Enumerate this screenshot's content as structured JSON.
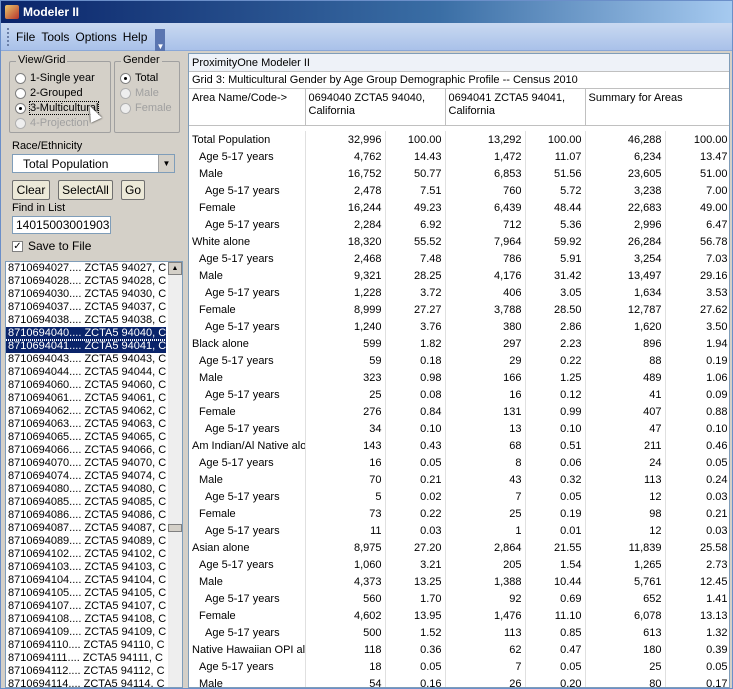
{
  "window": {
    "title": "Modeler II"
  },
  "menu": {
    "items": [
      "File",
      "Tools",
      "Options",
      "Help"
    ]
  },
  "viewgrid": {
    "legend": "View/Grid",
    "options": [
      "1-Single year",
      "2-Grouped",
      "3-Multicultural",
      "4-Projection"
    ],
    "selected": 2
  },
  "gender": {
    "legend": "Gender",
    "options": [
      "Total",
      "Male",
      "Female"
    ],
    "selected": 0
  },
  "race": {
    "label": "Race/Ethnicity",
    "value": "Total Population"
  },
  "buttons": {
    "clear": "Clear",
    "selectall": "SelectAll",
    "go": "Go"
  },
  "find": {
    "label": "Find in List",
    "value": "14015003001903"
  },
  "save": {
    "label": "Save to File",
    "checked": "✓"
  },
  "list": {
    "items": [
      "8710694027....  ZCTA5 94027, C",
      "8710694028....  ZCTA5 94028, C",
      "8710694030....  ZCTA5 94030, C",
      "8710694037....  ZCTA5 94037, C",
      "8710694038....  ZCTA5 94038, C",
      "8710694040....  ZCTA5 94040, C",
      "8710694041....  ZCTA5 94041, C",
      "8710694043....  ZCTA5 94043, C",
      "8710694044....  ZCTA5 94044, C",
      "8710694060....  ZCTA5 94060, C",
      "8710694061....  ZCTA5 94061, C",
      "8710694062....  ZCTA5 94062, C",
      "8710694063....  ZCTA5 94063, C",
      "8710694065....  ZCTA5 94065, C",
      "8710694066....  ZCTA5 94066, C",
      "8710694070....  ZCTA5 94070, C",
      "8710694074....  ZCTA5 94074, C",
      "8710694080....  ZCTA5 94080, C",
      "8710694085....  ZCTA5 94085, C",
      "8710694086....  ZCTA5 94086, C",
      "8710694087....  ZCTA5 94087, C",
      "8710694089....  ZCTA5 94089, C",
      "8710694102....  ZCTA5 94102, C",
      "8710694103....  ZCTA5 94103, C",
      "8710694104....  ZCTA5 94104, C",
      "8710694105....  ZCTA5 94105, C",
      "8710694107....  ZCTA5 94107, C",
      "8710694108....  ZCTA5 94108, C",
      "8710694109....  ZCTA5 94109, C",
      "8710694110....  ZCTA5 94110, C",
      "8710694111....  ZCTA5 94111, C",
      "8710694112....  ZCTA5 94112, C",
      "8710694114....  ZCTA5 94114, C"
    ],
    "selected": [
      5,
      6
    ]
  },
  "grid": {
    "title": "ProximityOne Modeler II",
    "subtitle": "Grid 3: Multicultural Gender by Age Group Demographic Profile -- Census 2010",
    "headers": [
      "Area Name/Code->",
      "0694040 ZCTA5 94040, California",
      "",
      "0694041 ZCTA5 94041, California",
      "",
      "Summary for Areas",
      ""
    ],
    "rows": [
      {
        "indent": 0,
        "cells": [
          "Total Population",
          "32,996",
          "100.00",
          "13,292",
          "100.00",
          "46,288",
          "100.00"
        ]
      },
      {
        "indent": 1,
        "cells": [
          "Age 5-17 years",
          "4,762",
          "14.43",
          "1,472",
          "11.07",
          "6,234",
          "13.47"
        ]
      },
      {
        "indent": 1,
        "cells": [
          "Male",
          "16,752",
          "50.77",
          "6,853",
          "51.56",
          "23,605",
          "51.00"
        ]
      },
      {
        "indent": 2,
        "cells": [
          "Age 5-17 years",
          "2,478",
          "7.51",
          "760",
          "5.72",
          "3,238",
          "7.00"
        ]
      },
      {
        "indent": 1,
        "cells": [
          "Female",
          "16,244",
          "49.23",
          "6,439",
          "48.44",
          "22,683",
          "49.00"
        ]
      },
      {
        "indent": 2,
        "cells": [
          "Age 5-17 years",
          "2,284",
          "6.92",
          "712",
          "5.36",
          "2,996",
          "6.47"
        ]
      },
      {
        "indent": 0,
        "cells": [
          "White alone",
          "18,320",
          "55.52",
          "7,964",
          "59.92",
          "26,284",
          "56.78"
        ]
      },
      {
        "indent": 1,
        "cells": [
          "Age 5-17 years",
          "2,468",
          "7.48",
          "786",
          "5.91",
          "3,254",
          "7.03"
        ]
      },
      {
        "indent": 1,
        "cells": [
          "Male",
          "9,321",
          "28.25",
          "4,176",
          "31.42",
          "13,497",
          "29.16"
        ]
      },
      {
        "indent": 2,
        "cells": [
          "Age 5-17 years",
          "1,228",
          "3.72",
          "406",
          "3.05",
          "1,634",
          "3.53"
        ]
      },
      {
        "indent": 1,
        "cells": [
          "Female",
          "8,999",
          "27.27",
          "3,788",
          "28.50",
          "12,787",
          "27.62"
        ]
      },
      {
        "indent": 2,
        "cells": [
          "Age 5-17 years",
          "1,240",
          "3.76",
          "380",
          "2.86",
          "1,620",
          "3.50"
        ]
      },
      {
        "indent": 0,
        "cells": [
          "Black alone",
          "599",
          "1.82",
          "297",
          "2.23",
          "896",
          "1.94"
        ]
      },
      {
        "indent": 1,
        "cells": [
          "Age 5-17 years",
          "59",
          "0.18",
          "29",
          "0.22",
          "88",
          "0.19"
        ]
      },
      {
        "indent": 1,
        "cells": [
          "Male",
          "323",
          "0.98",
          "166",
          "1.25",
          "489",
          "1.06"
        ]
      },
      {
        "indent": 2,
        "cells": [
          "Age 5-17 years",
          "25",
          "0.08",
          "16",
          "0.12",
          "41",
          "0.09"
        ]
      },
      {
        "indent": 1,
        "cells": [
          "Female",
          "276",
          "0.84",
          "131",
          "0.99",
          "407",
          "0.88"
        ]
      },
      {
        "indent": 2,
        "cells": [
          "Age 5-17 years",
          "34",
          "0.10",
          "13",
          "0.10",
          "47",
          "0.10"
        ]
      },
      {
        "indent": 0,
        "cells": [
          "Am Indian/Al Native alor",
          "143",
          "0.43",
          "68",
          "0.51",
          "211",
          "0.46"
        ]
      },
      {
        "indent": 1,
        "cells": [
          "Age 5-17 years",
          "16",
          "0.05",
          "8",
          "0.06",
          "24",
          "0.05"
        ]
      },
      {
        "indent": 1,
        "cells": [
          "Male",
          "70",
          "0.21",
          "43",
          "0.32",
          "113",
          "0.24"
        ]
      },
      {
        "indent": 2,
        "cells": [
          "Age 5-17 years",
          "5",
          "0.02",
          "7",
          "0.05",
          "12",
          "0.03"
        ]
      },
      {
        "indent": 1,
        "cells": [
          "Female",
          "73",
          "0.22",
          "25",
          "0.19",
          "98",
          "0.21"
        ]
      },
      {
        "indent": 2,
        "cells": [
          "Age 5-17 years",
          "11",
          "0.03",
          "1",
          "0.01",
          "12",
          "0.03"
        ]
      },
      {
        "indent": 0,
        "cells": [
          "Asian alone",
          "8,975",
          "27.20",
          "2,864",
          "21.55",
          "11,839",
          "25.58"
        ]
      },
      {
        "indent": 1,
        "cells": [
          "Age 5-17 years",
          "1,060",
          "3.21",
          "205",
          "1.54",
          "1,265",
          "2.73"
        ]
      },
      {
        "indent": 1,
        "cells": [
          "Male",
          "4,373",
          "13.25",
          "1,388",
          "10.44",
          "5,761",
          "12.45"
        ]
      },
      {
        "indent": 2,
        "cells": [
          "Age 5-17 years",
          "560",
          "1.70",
          "92",
          "0.69",
          "652",
          "1.41"
        ]
      },
      {
        "indent": 1,
        "cells": [
          "Female",
          "4,602",
          "13.95",
          "1,476",
          "11.10",
          "6,078",
          "13.13"
        ]
      },
      {
        "indent": 2,
        "cells": [
          "Age 5-17 years",
          "500",
          "1.52",
          "113",
          "0.85",
          "613",
          "1.32"
        ]
      },
      {
        "indent": 0,
        "cells": [
          "Native Hawaiian OPI alo",
          "118",
          "0.36",
          "62",
          "0.47",
          "180",
          "0.39"
        ]
      },
      {
        "indent": 1,
        "cells": [
          "Age 5-17 years",
          "18",
          "0.05",
          "7",
          "0.05",
          "25",
          "0.05"
        ]
      },
      {
        "indent": 1,
        "cells": [
          "Male",
          "54",
          "0.16",
          "26",
          "0.20",
          "80",
          "0.17"
        ]
      }
    ]
  }
}
